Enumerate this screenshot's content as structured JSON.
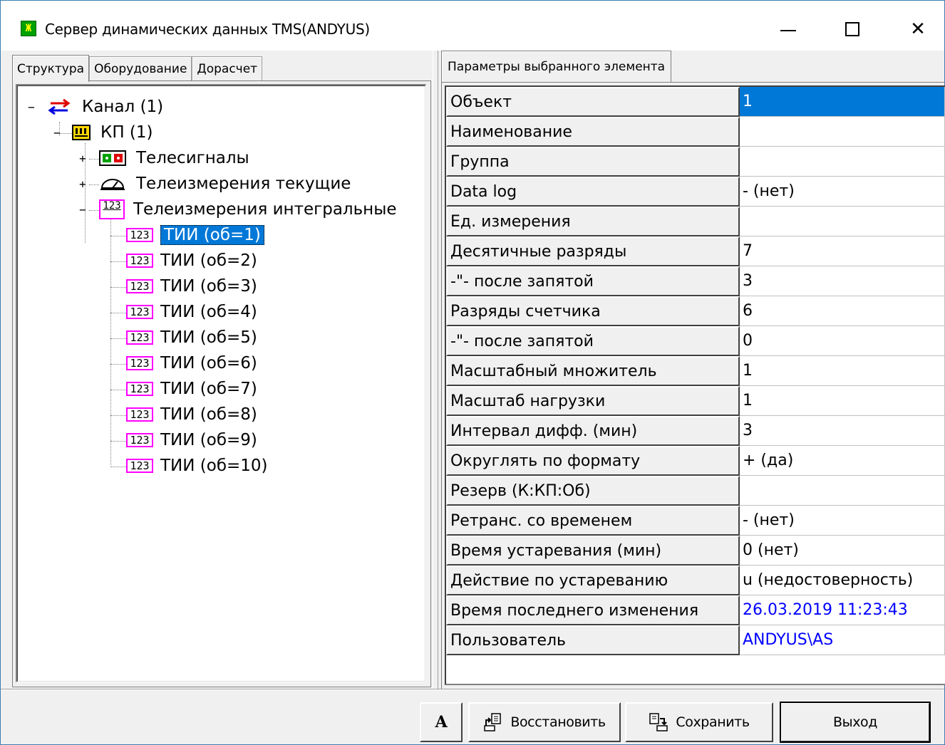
{
  "window": {
    "title": "Сервер динамических данных TMS(ANDYUS)",
    "app_icon_glyph": "Ж"
  },
  "left_tabs": [
    {
      "label": "Структура",
      "active": true
    },
    {
      "label": "Оборудование",
      "active": false
    },
    {
      "label": "Дорасчет",
      "active": false
    }
  ],
  "tree": {
    "channel": {
      "label": "Канал  (1)",
      "expander": "−"
    },
    "kp": {
      "label": "КП  (1)",
      "expander": "−"
    },
    "groups": [
      {
        "label": "Телесигналы",
        "expander": "+"
      },
      {
        "label": "Телеизмерения текущие",
        "expander": "+"
      },
      {
        "label": "Телеизмерения интегральные",
        "expander": "−"
      }
    ],
    "icon_text": "123",
    "items": [
      {
        "label": "ТИИ  (об=1)",
        "selected": true
      },
      {
        "label": "ТИИ  (об=2)",
        "selected": false
      },
      {
        "label": "ТИИ  (об=3)",
        "selected": false
      },
      {
        "label": "ТИИ  (об=4)",
        "selected": false
      },
      {
        "label": "ТИИ  (об=5)",
        "selected": false
      },
      {
        "label": "ТИИ  (об=6)",
        "selected": false
      },
      {
        "label": "ТИИ  (об=7)",
        "selected": false
      },
      {
        "label": "ТИИ  (об=8)",
        "selected": false
      },
      {
        "label": "ТИИ  (об=9)",
        "selected": false
      },
      {
        "label": "ТИИ  (об=10)",
        "selected": false
      }
    ]
  },
  "right_tab": {
    "label": "Параметры выбранного элемента"
  },
  "properties": [
    {
      "key": "Объект",
      "value": "1",
      "style": "selected"
    },
    {
      "key": "Наименование",
      "value": "",
      "style": ""
    },
    {
      "key": "Группа",
      "value": "",
      "style": ""
    },
    {
      "key": "Data log",
      "value": "- (нет)",
      "style": ""
    },
    {
      "key": "Ед. измерения",
      "value": "",
      "style": ""
    },
    {
      "key": "Десятичные разряды",
      "value": "7",
      "style": ""
    },
    {
      "key": "-\"- после запятой",
      "value": "3",
      "style": ""
    },
    {
      "key": "Разряды счетчика",
      "value": "6",
      "style": ""
    },
    {
      "key": "-\"- после запятой",
      "value": "0",
      "style": ""
    },
    {
      "key": "Масштабный множитель",
      "value": "1",
      "style": ""
    },
    {
      "key": "Масштаб нагрузки",
      "value": "1",
      "style": ""
    },
    {
      "key": "Интервал дифф. (мин)",
      "value": "3",
      "style": ""
    },
    {
      "key": "Округлять по формату",
      "value": "+ (да)",
      "style": ""
    },
    {
      "key": "Резерв (К:КП:Об)",
      "value": "",
      "style": ""
    },
    {
      "key": "Ретранс. со временем",
      "value": "- (нет)",
      "style": ""
    },
    {
      "key": "Время устаревания (мин)",
      "value": "0 (нет)",
      "style": ""
    },
    {
      "key": "Действие по устареванию",
      "value": "u (недостоверность)",
      "style": ""
    },
    {
      "key": "Время последнего изменения",
      "value": "26.03.2019 11:23:43",
      "style": "blue"
    },
    {
      "key": "Пользователь",
      "value": "ANDYUS\\AS",
      "style": "blue"
    }
  ],
  "buttons": {
    "font": "A",
    "restore": "Восстановить",
    "save": "Сохранить",
    "exit": "Выход"
  },
  "colors": {
    "selection": "#0078d7",
    "link_blue": "#0000ff",
    "icon_magenta": "#ff00ff"
  }
}
